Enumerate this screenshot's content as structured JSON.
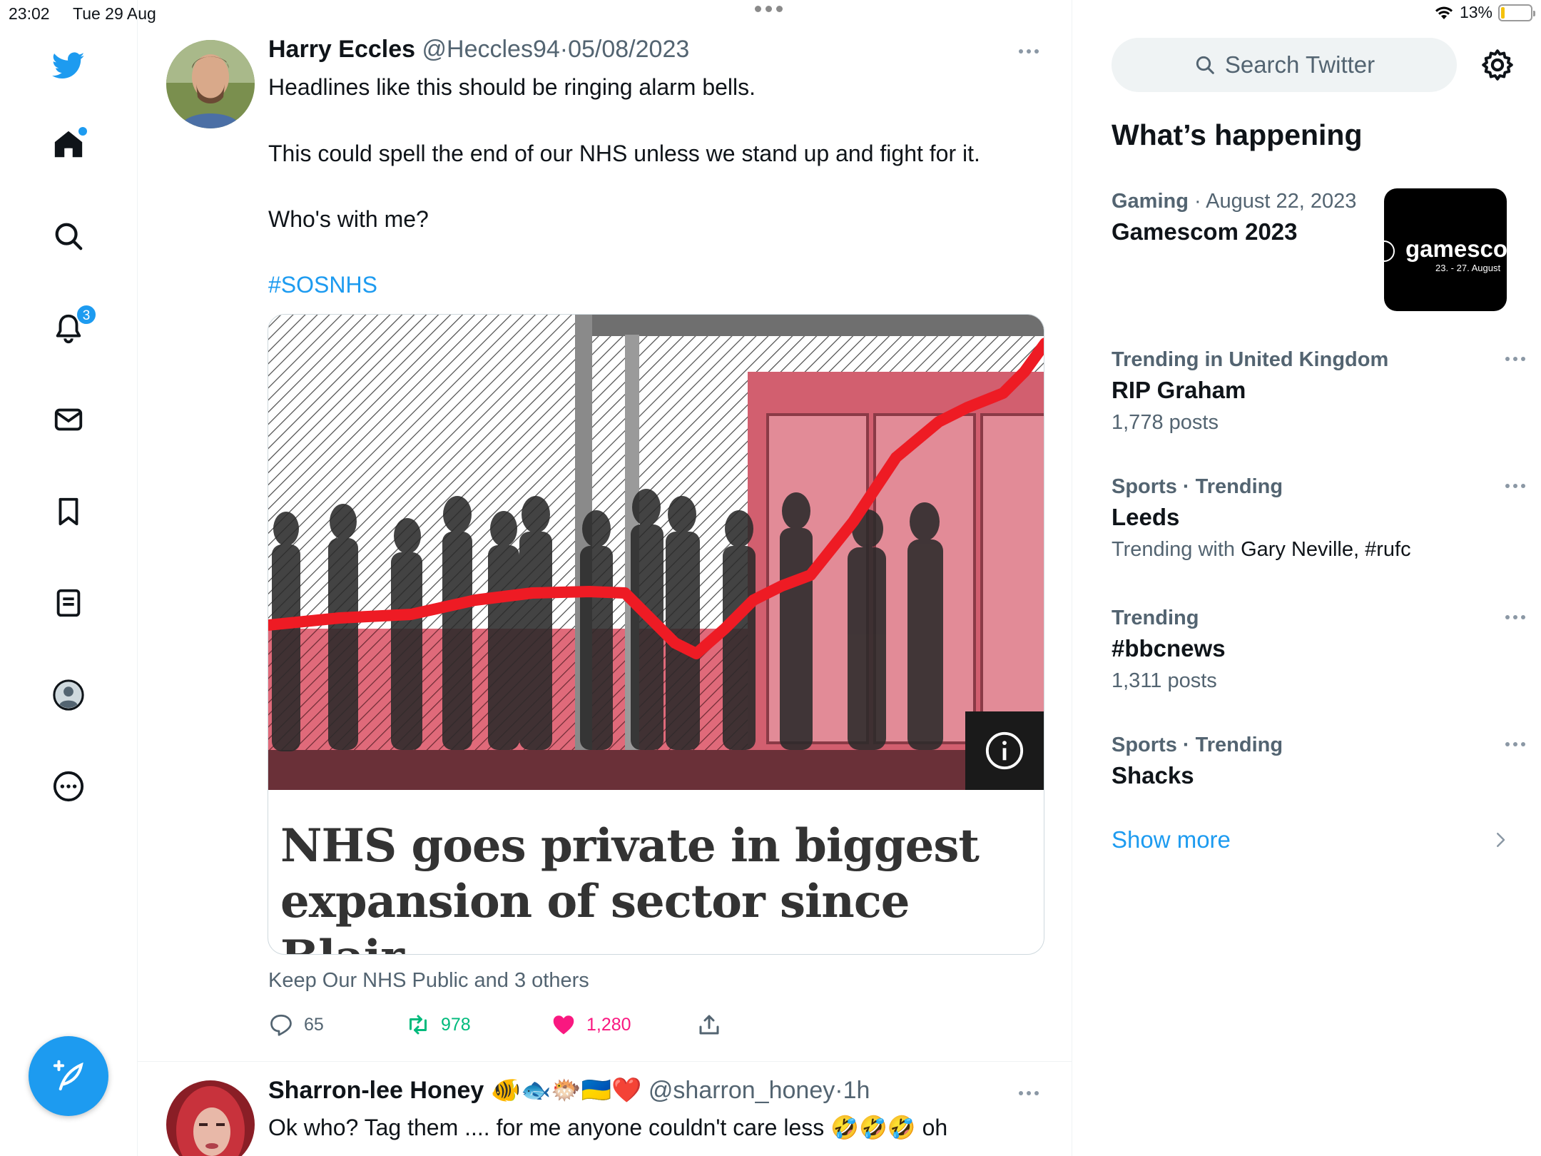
{
  "status_bar": {
    "time": "23:02",
    "date": "Tue 29 Aug",
    "battery": "13%",
    "battery_level": 0.13
  },
  "nav": {
    "items": [
      "twitter-logo",
      "home-icon",
      "search-icon",
      "bell-icon",
      "mail-icon",
      "bookmark-icon",
      "lists-icon",
      "profile-icon",
      "more-icon"
    ],
    "notifications_badge": "3",
    "accent_color": "#1d9bf0"
  },
  "tweets": [
    {
      "name": "Harry Eccles",
      "handle": "@Heccles94",
      "date": "05/08/2023",
      "separator": "·",
      "text_lines": [
        "Headlines like this should be ringing alarm bells.",
        "This could spell the end of our NHS unless we stand up and fight for it.",
        "Who's with me?"
      ],
      "hashtag": "#SOSNHS",
      "card": {
        "headline_line1": "NHS goes private in biggest",
        "headline_line2": "expansion of sector since Blair"
      },
      "social_context": "Keep Our NHS Public and 3 others",
      "replies": "65",
      "retweets": "978",
      "likes": "1,280"
    },
    {
      "name": "Sharron-lee Honey",
      "emojis": "🐠🐟🐡🇺🇦❤️",
      "handle": "@sharron_honey",
      "separator": "·",
      "time": "1h",
      "text": "Ok who? Tag them .... for me anyone couldn't care less 🤣🤣🤣 oh"
    }
  ],
  "sidebar": {
    "search_placeholder": "Search Twitter",
    "whats_happening": "What’s happening",
    "trends": [
      {
        "category": "Gaming",
        "date": "August 22, 2023",
        "topic": "Gamescom 2023",
        "thumb_text": "gamesco",
        "thumb_sub": "23. - 27. August"
      },
      {
        "category": "Trending in United Kingdom",
        "topic": "RIP Graham",
        "meta": "1,778 posts"
      },
      {
        "category": "Sports · Trending",
        "topic": "Leeds",
        "meta_prefix": "Trending with",
        "meta_with": "Gary Neville, #rufc"
      },
      {
        "category": "Trending",
        "topic": "#bbcnews",
        "meta": "1,311 posts"
      },
      {
        "category": "Sports · Trending",
        "topic": "Shacks"
      }
    ],
    "show_more": "Show more"
  }
}
